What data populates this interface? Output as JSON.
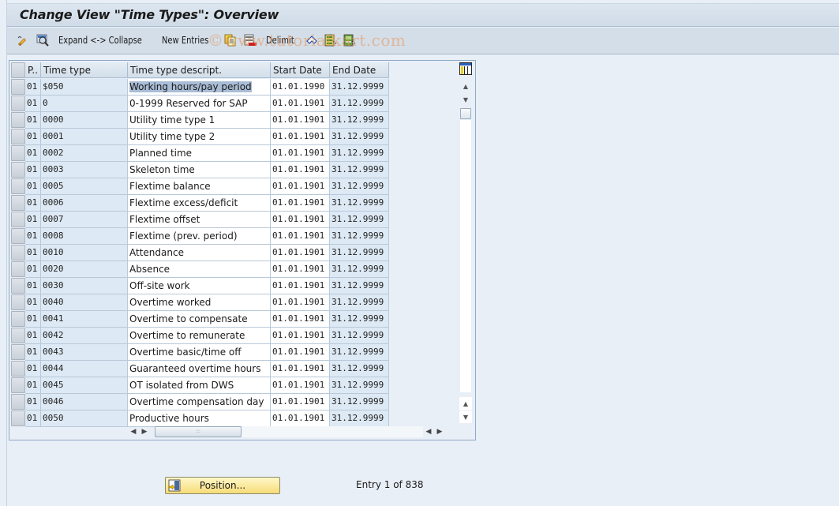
{
  "window": {
    "title": "Change View \"Time Types\": Overview"
  },
  "toolbar": {
    "items": [
      {
        "icon": "edit-pencil-icon",
        "label": ""
      },
      {
        "icon": "display-magnifier-icon",
        "label": ""
      },
      {
        "icon": "",
        "label": "Expand <-> Collapse"
      },
      {
        "icon": "",
        "label": "New Entries"
      },
      {
        "icon": "copy-as-icon",
        "label": ""
      },
      {
        "icon": "delete-icon",
        "label": ""
      },
      {
        "icon": "",
        "label": "Delimit"
      },
      {
        "icon": "undo-change-icon",
        "label": ""
      },
      {
        "icon": "select-all-icon",
        "label": ""
      },
      {
        "icon": "select-block-icon",
        "label": ""
      }
    ],
    "expand_collapse_label": "Expand <-> Collapse",
    "new_entries_label": "New Entries",
    "delimit_label": "Delimit"
  },
  "watermark": "©www.tutorialkart.com",
  "table": {
    "columns": [
      "P..",
      "Time type",
      "Time type descript.",
      "Start Date",
      "End Date"
    ],
    "rows": [
      {
        "p": "01",
        "type": "$050",
        "desc": "Working hours/pay period",
        "start": "01.01.1990",
        "end": "31.12.9999",
        "highlight": true
      },
      {
        "p": "01",
        "type": "0",
        "desc": "0-1999 Reserved for SAP",
        "start": "01.01.1901",
        "end": "31.12.9999"
      },
      {
        "p": "01",
        "type": "0000",
        "desc": "Utility time type 1",
        "start": "01.01.1901",
        "end": "31.12.9999"
      },
      {
        "p": "01",
        "type": "0001",
        "desc": "Utility time type 2",
        "start": "01.01.1901",
        "end": "31.12.9999"
      },
      {
        "p": "01",
        "type": "0002",
        "desc": "Planned time",
        "start": "01.01.1901",
        "end": "31.12.9999"
      },
      {
        "p": "01",
        "type": "0003",
        "desc": "Skeleton time",
        "start": "01.01.1901",
        "end": "31.12.9999"
      },
      {
        "p": "01",
        "type": "0005",
        "desc": "Flextime balance",
        "start": "01.01.1901",
        "end": "31.12.9999"
      },
      {
        "p": "01",
        "type": "0006",
        "desc": "Flextime excess/deficit",
        "start": "01.01.1901",
        "end": "31.12.9999"
      },
      {
        "p": "01",
        "type": "0007",
        "desc": "Flextime offset",
        "start": "01.01.1901",
        "end": "31.12.9999"
      },
      {
        "p": "01",
        "type": "0008",
        "desc": "Flextime (prev. period)",
        "start": "01.01.1901",
        "end": "31.12.9999"
      },
      {
        "p": "01",
        "type": "0010",
        "desc": "Attendance",
        "start": "01.01.1901",
        "end": "31.12.9999"
      },
      {
        "p": "01",
        "type": "0020",
        "desc": "Absence",
        "start": "01.01.1901",
        "end": "31.12.9999"
      },
      {
        "p": "01",
        "type": "0030",
        "desc": "Off-site work",
        "start": "01.01.1901",
        "end": "31.12.9999"
      },
      {
        "p": "01",
        "type": "0040",
        "desc": "Overtime worked",
        "start": "01.01.1901",
        "end": "31.12.9999"
      },
      {
        "p": "01",
        "type": "0041",
        "desc": "Overtime to compensate",
        "start": "01.01.1901",
        "end": "31.12.9999"
      },
      {
        "p": "01",
        "type": "0042",
        "desc": "Overtime to remunerate",
        "start": "01.01.1901",
        "end": "31.12.9999"
      },
      {
        "p": "01",
        "type": "0043",
        "desc": "Overtime basic/time off",
        "start": "01.01.1901",
        "end": "31.12.9999"
      },
      {
        "p": "01",
        "type": "0044",
        "desc": "Guaranteed overtime hours",
        "start": "01.01.1901",
        "end": "31.12.9999"
      },
      {
        "p": "01",
        "type": "0045",
        "desc": "OT isolated from DWS",
        "start": "01.01.1901",
        "end": "31.12.9999"
      },
      {
        "p": "01",
        "type": "0046",
        "desc": "Overtime compensation day",
        "start": "01.01.1901",
        "end": "31.12.9999"
      },
      {
        "p": "01",
        "type": "0050",
        "desc": "Productive hours",
        "start": "01.01.1901",
        "end": "31.12.9999"
      }
    ]
  },
  "footer": {
    "position_label": "Position...",
    "entry_text": "Entry 1 of 838"
  }
}
